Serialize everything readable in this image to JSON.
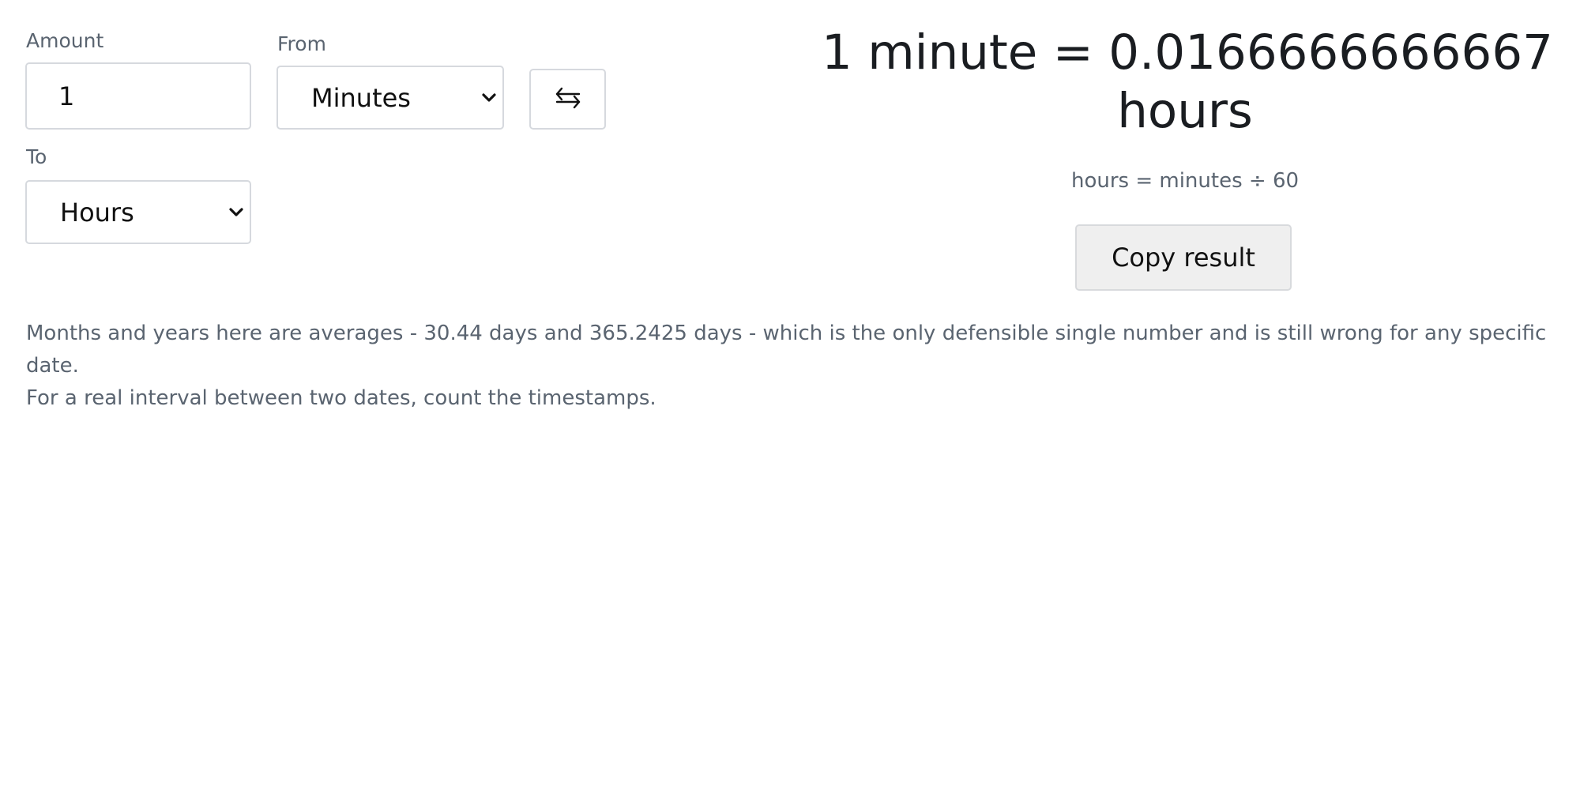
{
  "form": {
    "amount": {
      "label": "Amount",
      "value": "1"
    },
    "from": {
      "label": "From",
      "selected": "Minutes"
    },
    "to": {
      "label": "To",
      "selected": "Hours"
    },
    "swap_icon": "swap-arrows-icon"
  },
  "result": {
    "line1": "1 minute = 0.0166666666667",
    "line2": "hours",
    "formula": "hours = minutes ÷ 60",
    "copy_label": "Copy result"
  },
  "note": {
    "line1": "Months and years here are averages - 30.44 days and 365.2425 days - which is the only defensible single number and is still wrong for any specific date.",
    "line2": "For a real interval between two dates, count the timestamps."
  }
}
